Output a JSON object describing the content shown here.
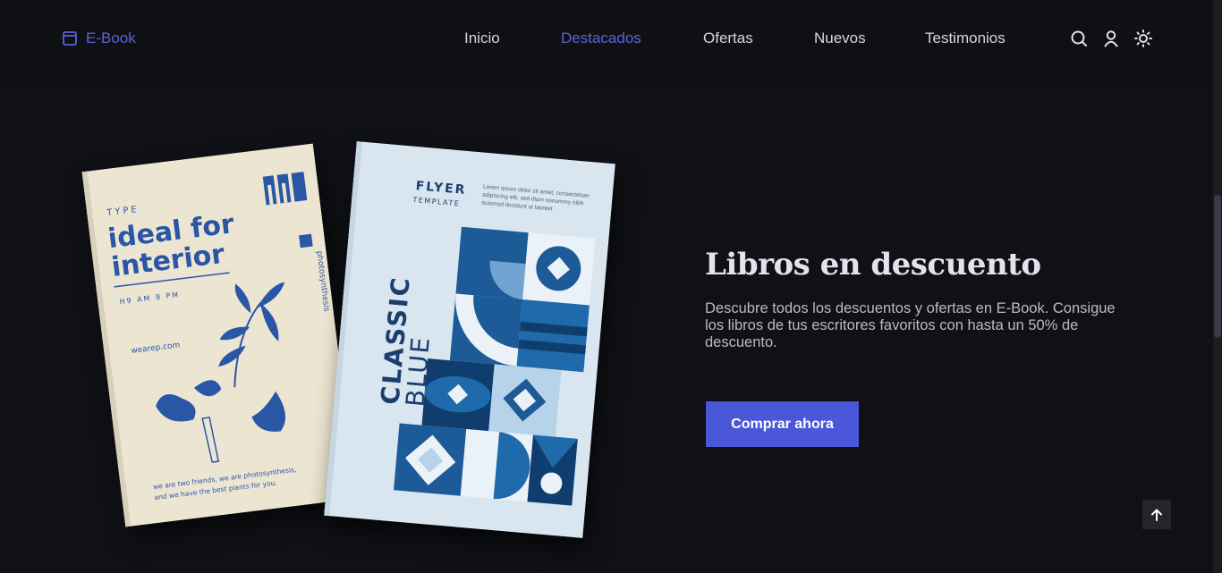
{
  "header": {
    "logo_label": "E-Book",
    "nav": [
      {
        "label": "Inicio",
        "active": false
      },
      {
        "label": "Destacados",
        "active": true
      },
      {
        "label": "Ofertas",
        "active": false
      },
      {
        "label": "Nuevos",
        "active": false
      },
      {
        "label": "Testimonios",
        "active": false
      }
    ],
    "icons": [
      "search-icon",
      "user-icon",
      "sun-icon"
    ]
  },
  "hero": {
    "title": "Libros en descuento",
    "text": "Descubre todos los descuentos y ofertas en E-Book. Consigue los libros de tus escritores favoritos con hasta un 50% de descuento.",
    "button_label": "Comprar ahora"
  },
  "book1": {
    "type_label": "TYPE",
    "title_line1": "ideal for",
    "title_line2": "interior",
    "hours": "H9 AM 9 PM",
    "website": "wearep.com",
    "brand_side": "photosynthesis",
    "footer_line1": "we are two friends, we are photosynthesis,",
    "footer_line2": "and we have the best plants for you."
  },
  "book2": {
    "heading": "FLYER",
    "subheading": "TEMPLATE",
    "lorem": "Lorem ipsum dolor sit amet, consectetuer adipiscing elit, sed diam nonummy nibh euismod tincidunt ut laoreet",
    "title_bold": "CLASSIC",
    "title_light": "BLUE"
  },
  "colors": {
    "background": "#101116",
    "accent": "#5b63d9",
    "button": "#4a57d8",
    "book_blue": "#1c5a98"
  }
}
